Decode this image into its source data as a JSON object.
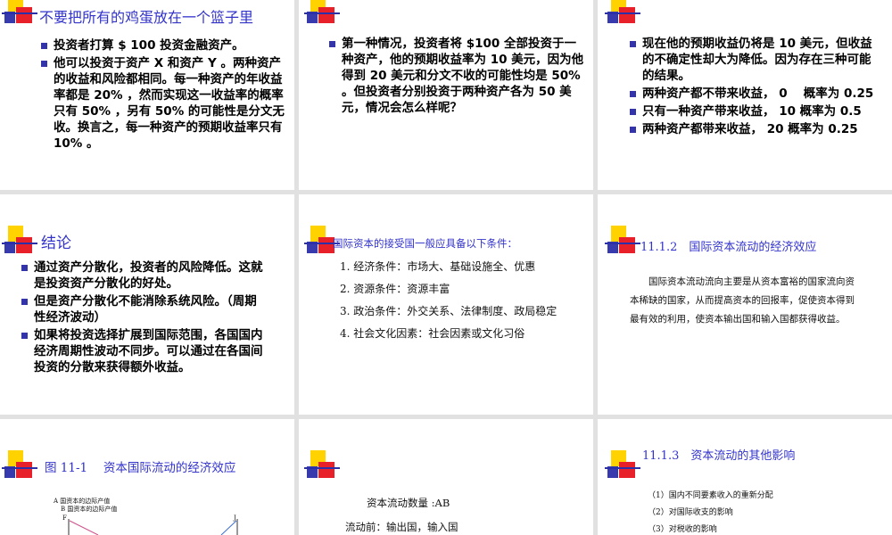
{
  "slide1": {
    "title": "不要把所有的鸡蛋放在一个篮子里",
    "bullets": [
      "投资者打算 $ 100 投资金融资产。",
      "他可以投资于资产 X 和资产 Y 。两种资产的收益和风险都相同。每一种资产的年收益率都是 20% ，然而实现这一收益率的概率只有 50% ，另有 50% 的可能性是分文无收。换言之，每一种资产的预期收益率只有 10% 。"
    ]
  },
  "slide2": {
    "bullets": [
      "第一种情况，投资者将 $100 全部投资于一种资产，他的预期收益率为 10 美元，因为他得到 20 美元和分文不收的可能性均是 50% 。但投资者分别投资于两种资产各为 50 美元，情况会怎么样呢？"
    ]
  },
  "slide3": {
    "bullets": [
      "现在他的预期收益仍将是 10 美元，但收益的不确定性却大为降低。因为存在三种可能的结果。",
      "两种资产都不带来收益， 0　 概率为 0.25",
      "只有一种资产带来收益， 10 概率为 0.5",
      "两种资产都带来收益， 20 概率为 0.25"
    ]
  },
  "slide4": {
    "title": "结论",
    "bullets": [
      "通过资产分散化，投资者的风险降低。这就是投资资产分散化的好处。",
      "但是资产分散化不能消除系统风险。（周期性经济波动）",
      "如果将投资选择扩展到国际范围，各国国内经济周期性波动不同步。可以通过在各国间投资的分散来获得额外收益。"
    ]
  },
  "slide5": {
    "title": "国际资本的接受国一般应具备以下条件：",
    "items": [
      "1. 经济条件：市场大、基础设施全、优惠",
      "2. 资源条件：资源丰富",
      "3. 政治条件：外交关系、法律制度、政局稳定",
      "4. 社会文化因素：社会因素或文化习俗"
    ]
  },
  "slide6": {
    "title": "11.1.2　国际资本流动的经济效应",
    "paragraph": "国际资本流动流向主要是从资本富裕的国家流向资本稀缺的国家，从而提高资本的回报率，促使资本得到最有效的利用，使资本输出国和输入国都获得收益。"
  },
  "slide7": {
    "title": "图 11-1　 资本国际流动的经济效应",
    "legend_a": "A 国资本的边际产值",
    "legend_b": "B 国资本的边际产值",
    "label_f": "F",
    "label_j": "J"
  },
  "slide8": {
    "line1": "资本流动数量 :AB",
    "line2": "流动前：输出国，输入国"
  },
  "slide9": {
    "title": "11.1.3　资本流动的其他影响",
    "items": [
      "（1）国内不同要素收入的重新分配",
      "（2）对国际收支的影响",
      "（3）对税收的影响"
    ]
  },
  "colors": {
    "title": "#3333cc",
    "bullet": "#3333aa",
    "background": "#e1e1e1"
  }
}
